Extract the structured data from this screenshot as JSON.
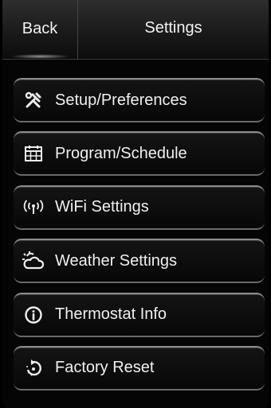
{
  "header": {
    "back_label": "Back",
    "title": "Settings"
  },
  "menu": {
    "items": [
      {
        "label": "Setup/Preferences",
        "icon": "tools-icon"
      },
      {
        "label": "Program/Schedule",
        "icon": "calendar-icon"
      },
      {
        "label": "WiFi Settings",
        "icon": "wifi-antenna-icon"
      },
      {
        "label": "Weather Settings",
        "icon": "weather-icon"
      },
      {
        "label": "Thermostat Info",
        "icon": "info-icon"
      },
      {
        "label": "Factory Reset",
        "icon": "reset-icon"
      }
    ]
  }
}
